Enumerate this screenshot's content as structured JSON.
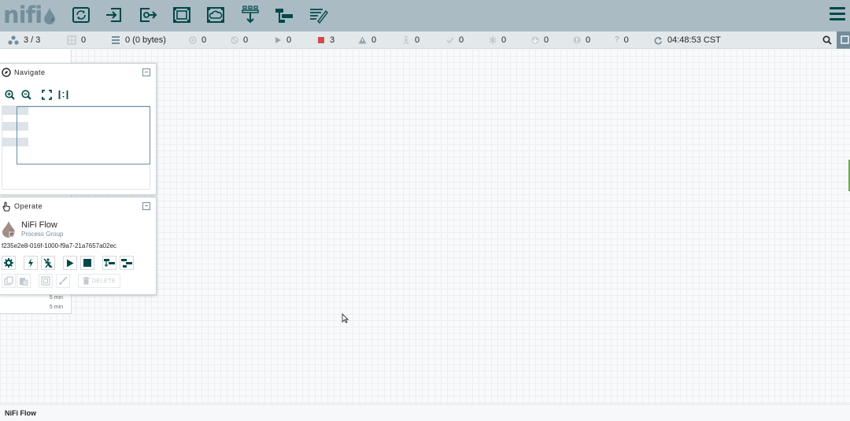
{
  "header": {
    "logo_text": "nifi",
    "components": [
      {
        "name": "processor"
      },
      {
        "name": "input-port"
      },
      {
        "name": "output-port"
      },
      {
        "name": "process-group"
      },
      {
        "name": "remote-process-group"
      },
      {
        "name": "funnel"
      },
      {
        "name": "template"
      },
      {
        "name": "label"
      }
    ],
    "menu_icon": "hamburger-icon"
  },
  "status": {
    "transmitting": "3 / 3",
    "components": "0",
    "queued": "0 (0 bytes)",
    "transmitting_ports": "0",
    "not_transmitting_ports": "0",
    "running": "0",
    "stopped": "3",
    "invalid": "0",
    "disabled": "0",
    "up_to_date": "0",
    "locally_modified": "0",
    "stale": "0",
    "locally_modified_stale": "0",
    "sync_failure": "0",
    "refresh_time": "04:48:53 CST"
  },
  "stub": {
    "time1": "5 min",
    "time2": "5 min"
  },
  "navigate": {
    "title": "Navigate"
  },
  "operate": {
    "title": "Operate",
    "name": "NiFi Flow",
    "type": "Process Group",
    "id": "f235e2e8-016f-1000-f9a7-21a7657a02ec",
    "delete_label": "DELETE"
  },
  "breadcrumb": {
    "current": "NiFi Flow"
  },
  "colors": {
    "header_bg": "#aabbc3",
    "accent": "#004849",
    "muted": "#728e9b",
    "stopped": "#d14b4b"
  }
}
